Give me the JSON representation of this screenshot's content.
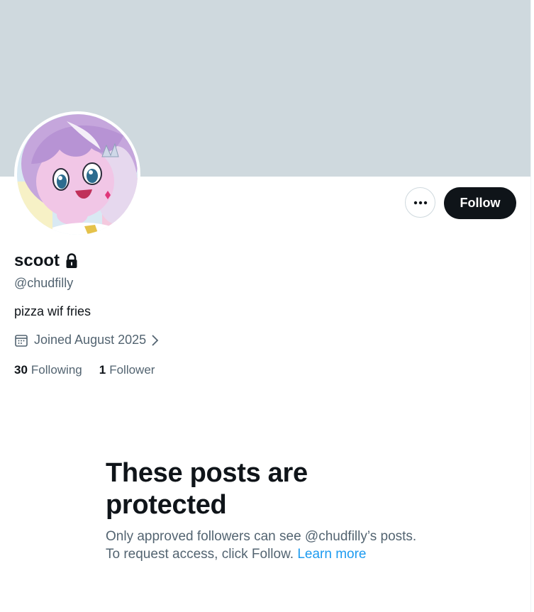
{
  "profile": {
    "display_name": "scoot",
    "handle": "@chudfilly",
    "bio": "pizza wif fries",
    "joined": "Joined August 2025",
    "following_count": "30",
    "following_label": "Following",
    "followers_count": "1",
    "followers_label": "Follower"
  },
  "actions": {
    "follow_label": "Follow",
    "more_icon": "more-horizontal-icon"
  },
  "protected": {
    "title": "These posts are protected",
    "line1": "Only approved followers can see @chudfilly’s posts.",
    "line2": "To request access, click Follow.",
    "learn_more": "Learn more"
  },
  "colors": {
    "banner": "#cfd9de",
    "primary_text": "#0f1419",
    "secondary_text": "#536471",
    "link": "#1d9bf0",
    "follow_button_bg": "#0f1419"
  }
}
